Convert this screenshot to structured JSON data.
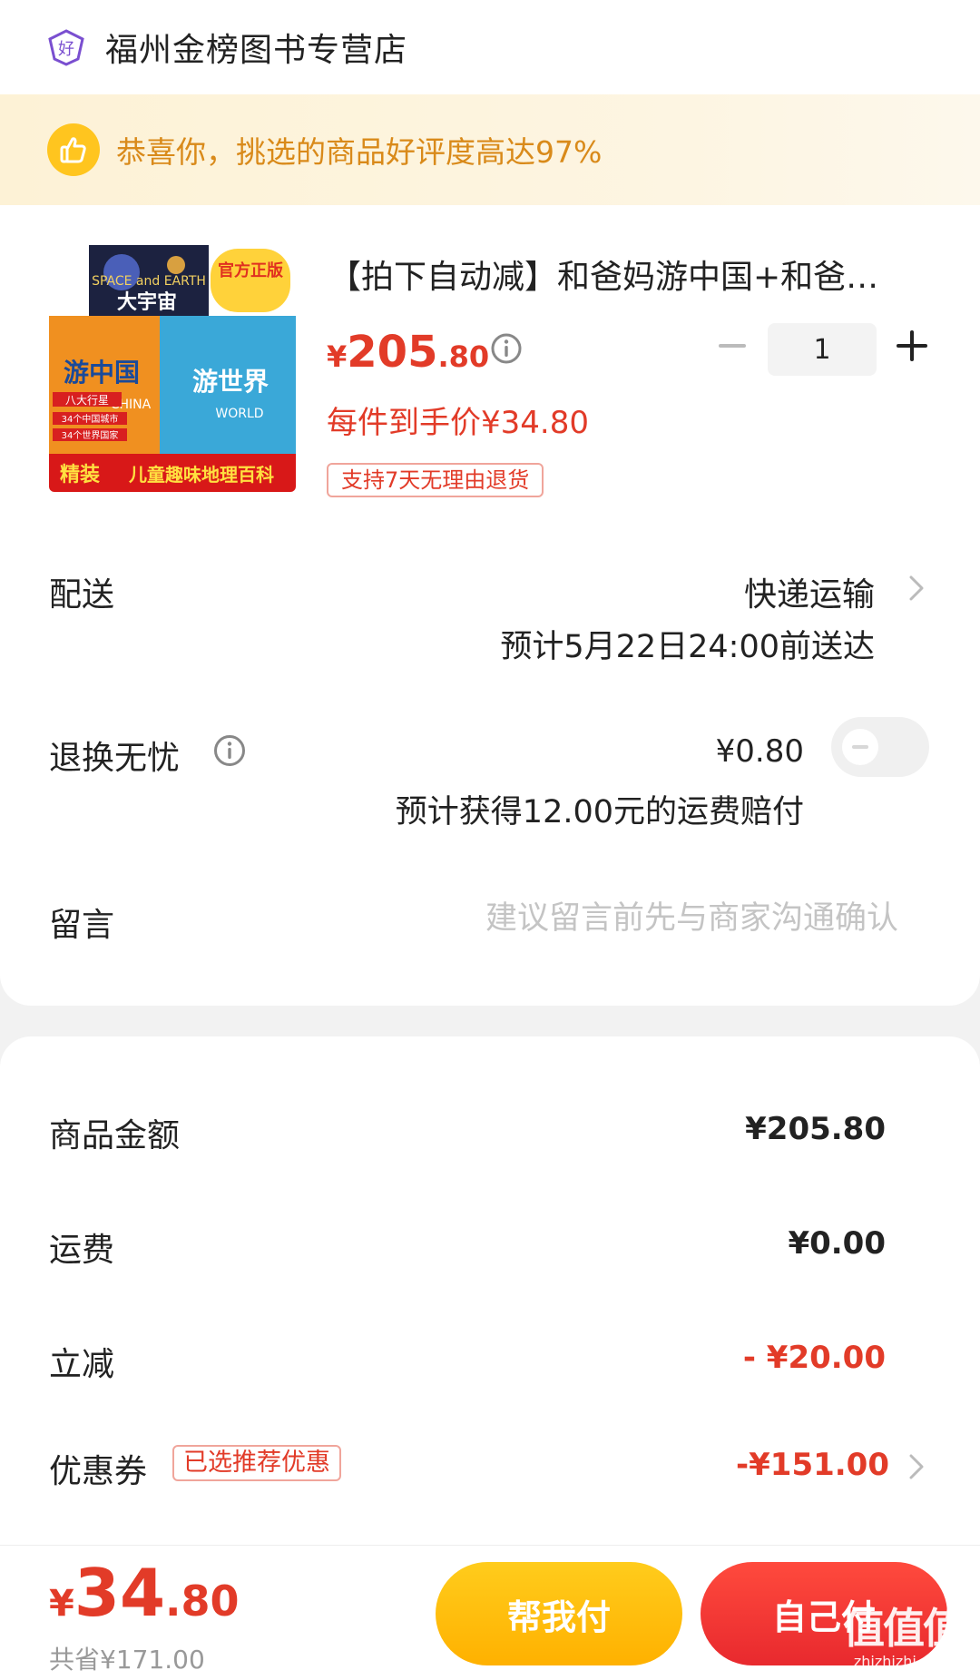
{
  "shop": {
    "badge_char": "好",
    "name": "福州金榜图书专营店"
  },
  "banner": {
    "text": "恭喜你，挑选的商品好评度高达97%"
  },
  "product": {
    "image_texts": {
      "official": "官方正版",
      "space": "SPACE and EARTH",
      "universe": "大宇宙",
      "china": "游中国",
      "world": "游世界",
      "planets": "八大行星",
      "cities": "34个中国城市",
      "countries": "34个世界国家",
      "china_en": "CHINA",
      "world_en": "WORLD",
      "hardcover": "精装",
      "encyclopedia": "儿童趣味地理百科"
    },
    "title": "【拍下自动减】和爸妈游中国+和爸…",
    "price_currency": "¥",
    "price_int": "205",
    "price_dec": ".80",
    "each_price": "每件到手价¥34.80",
    "return_badge": "支持7天无理由退货",
    "quantity": "1"
  },
  "delivery": {
    "label": "配送",
    "method": "快递运输",
    "eta": "预计5月22日24:00前送达"
  },
  "worry_free": {
    "label": "退换无忧",
    "price": "¥0.80",
    "note": "预计获得12.00元的运费赔付",
    "enabled": false
  },
  "message": {
    "label": "留言",
    "placeholder": "建议留言前先与商家沟通确认"
  },
  "summary": {
    "goods_label": "商品金额",
    "goods_value": "¥205.80",
    "shipping_label": "运费",
    "shipping_value": "¥0.00",
    "discount_label": "立减",
    "discount_value": "- ¥20.00",
    "coupon_label": "优惠券",
    "coupon_badge": "已选推荐优惠",
    "coupon_value": "-¥151.00"
  },
  "bottom": {
    "total_currency": "¥",
    "total_int": "34",
    "total_dec": ".80",
    "saved": "共省¥171.00",
    "help_pay": "帮我付",
    "self_pay": "自己付"
  },
  "watermark": {
    "mark": "值值值",
    "site": "zhizhizhi.com"
  },
  "colors": {
    "accent_red": "#e23b28",
    "banner_text": "#d98a1a",
    "button_yellow": "#ffbe0f",
    "button_red": "#f0352f",
    "shop_icon": "#7a4fd0"
  }
}
